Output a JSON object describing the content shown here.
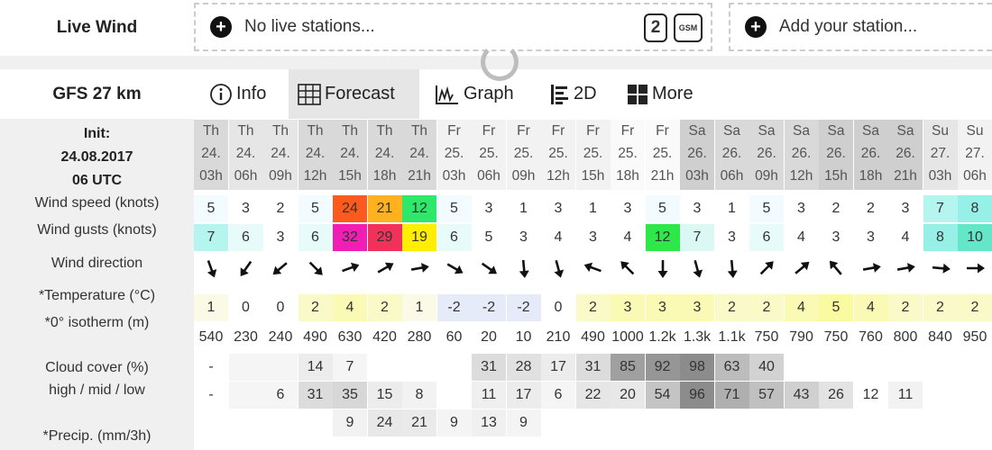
{
  "live": {
    "label": "Live Wind",
    "no_stations": "No live stations...",
    "add_station": "Add your station...",
    "badge_2": "2",
    "badge_gsm": "GSM"
  },
  "model": "GFS 27 km",
  "tabs": [
    {
      "label": "Info",
      "icon": "info-icon",
      "active": false
    },
    {
      "label": "Forecast",
      "icon": "grid-icon",
      "active": true
    },
    {
      "label": "Graph",
      "icon": "graph-icon",
      "active": false
    },
    {
      "label": "2D",
      "icon": "bars-icon",
      "active": false
    },
    {
      "label": "More",
      "icon": "squares-icon",
      "active": false
    }
  ],
  "init": {
    "title": "Init:",
    "date": "24.08.2017",
    "time": "06 UTC"
  },
  "labels": {
    "wind_speed": "Wind speed (knots)",
    "wind_gusts": "Wind gusts (knots)",
    "wind_direction": "Wind direction",
    "temperature": "*Temperature (°C)",
    "isotherm": "*0° isotherm (m)",
    "cloud_cover": "Cloud cover (%)",
    "cloud_layers": "high / mid / low",
    "precip": "*Precip. (mm/3h)"
  },
  "columns": [
    {
      "day": "Th",
      "date": "24.",
      "hour": "03h"
    },
    {
      "day": "Th",
      "date": "24.",
      "hour": "06h"
    },
    {
      "day": "Th",
      "date": "24.",
      "hour": "09h"
    },
    {
      "day": "Th",
      "date": "24.",
      "hour": "12h"
    },
    {
      "day": "Th",
      "date": "24.",
      "hour": "15h"
    },
    {
      "day": "Th",
      "date": "24.",
      "hour": "18h"
    },
    {
      "day": "Th",
      "date": "24.",
      "hour": "21h"
    },
    {
      "day": "Fr",
      "date": "25.",
      "hour": "03h"
    },
    {
      "day": "Fr",
      "date": "25.",
      "hour": "06h"
    },
    {
      "day": "Fr",
      "date": "25.",
      "hour": "09h"
    },
    {
      "day": "Fr",
      "date": "25.",
      "hour": "12h"
    },
    {
      "day": "Fr",
      "date": "25.",
      "hour": "15h"
    },
    {
      "day": "Fr",
      "date": "25.",
      "hour": "18h"
    },
    {
      "day": "Fr",
      "date": "25.",
      "hour": "21h"
    },
    {
      "day": "Sa",
      "date": "26.",
      "hour": "03h"
    },
    {
      "day": "Sa",
      "date": "26.",
      "hour": "06h"
    },
    {
      "day": "Sa",
      "date": "26.",
      "hour": "09h"
    },
    {
      "day": "Sa",
      "date": "26.",
      "hour": "12h"
    },
    {
      "day": "Sa",
      "date": "26.",
      "hour": "15h"
    },
    {
      "day": "Sa",
      "date": "26.",
      "hour": "18h"
    },
    {
      "day": "Sa",
      "date": "26.",
      "hour": "21h"
    },
    {
      "day": "Su",
      "date": "27.",
      "hour": "03h"
    },
    {
      "day": "Su",
      "date": "27.",
      "hour": "06h"
    }
  ],
  "header_shades": [
    "#d9d9d9",
    "#e6e6e6",
    "#e6e6e6",
    "#d9d9d9",
    "#d9d9d9",
    "#d9d9d9",
    "#d9d9d9",
    "#f2f2f2",
    "#f2f2f2",
    "#f2f2f2",
    "#f2f2f2",
    "#f2f2f2",
    "#fafafa",
    "#fafafa",
    "#cfcfcf",
    "#d9d9d9",
    "#d9d9d9",
    "#d9d9d9",
    "#cfcfcf",
    "#cfcfcf",
    "#cfcfcf",
    "#e6e6e6",
    "#f2f2f2"
  ],
  "wind_speed": [
    {
      "v": "5",
      "bg": "#f2fbff"
    },
    {
      "v": "3",
      "bg": ""
    },
    {
      "v": "2",
      "bg": ""
    },
    {
      "v": "5",
      "bg": "#f2fbff"
    },
    {
      "v": "24",
      "bg": "#ff5a1e"
    },
    {
      "v": "21",
      "bg": "#ffb21e"
    },
    {
      "v": "12",
      "bg": "#2ee86a"
    },
    {
      "v": "5",
      "bg": "#f2fbff"
    },
    {
      "v": "3",
      "bg": ""
    },
    {
      "v": "1",
      "bg": ""
    },
    {
      "v": "3",
      "bg": ""
    },
    {
      "v": "1",
      "bg": ""
    },
    {
      "v": "3",
      "bg": ""
    },
    {
      "v": "5",
      "bg": "#f2fbff"
    },
    {
      "v": "3",
      "bg": ""
    },
    {
      "v": "1",
      "bg": ""
    },
    {
      "v": "5",
      "bg": "#f2fbff"
    },
    {
      "v": "3",
      "bg": ""
    },
    {
      "v": "2",
      "bg": ""
    },
    {
      "v": "2",
      "bg": ""
    },
    {
      "v": "3",
      "bg": ""
    },
    {
      "v": "7",
      "bg": "#b4f5f0"
    },
    {
      "v": "8",
      "bg": "#96f0e8"
    }
  ],
  "wind_gusts": [
    {
      "v": "7",
      "bg": "#b4f5f0"
    },
    {
      "v": "6",
      "bg": "#e6fbfa"
    },
    {
      "v": "3",
      "bg": ""
    },
    {
      "v": "6",
      "bg": "#e6fbfa"
    },
    {
      "v": "32",
      "bg": "#f01eb4"
    },
    {
      "v": "29",
      "bg": "#f0325a"
    },
    {
      "v": "19",
      "bg": "#ffee00"
    },
    {
      "v": "6",
      "bg": "#e6fbfa"
    },
    {
      "v": "5",
      "bg": ""
    },
    {
      "v": "3",
      "bg": ""
    },
    {
      "v": "4",
      "bg": ""
    },
    {
      "v": "3",
      "bg": ""
    },
    {
      "v": "4",
      "bg": ""
    },
    {
      "v": "12",
      "bg": "#2ee84a"
    },
    {
      "v": "7",
      "bg": "#dcf8f5"
    },
    {
      "v": "3",
      "bg": ""
    },
    {
      "v": "6",
      "bg": "#e6fbfa"
    },
    {
      "v": "4",
      "bg": ""
    },
    {
      "v": "3",
      "bg": ""
    },
    {
      "v": "3",
      "bg": ""
    },
    {
      "v": "4",
      "bg": ""
    },
    {
      "v": "8",
      "bg": "#96f0e8"
    },
    {
      "v": "10",
      "bg": "#64e6c8"
    }
  ],
  "wind_direction_deg": [
    160,
    215,
    230,
    135,
    70,
    60,
    80,
    120,
    125,
    175,
    165,
    290,
    315,
    180,
    165,
    175,
    45,
    50,
    320,
    80,
    80,
    95,
    90
  ],
  "temperature": [
    {
      "v": "1",
      "bg": "#fafae6"
    },
    {
      "v": "0",
      "bg": ""
    },
    {
      "v": "0",
      "bg": ""
    },
    {
      "v": "2",
      "bg": "#fafac8"
    },
    {
      "v": "4",
      "bg": "#fafab4"
    },
    {
      "v": "2",
      "bg": "#fafac8"
    },
    {
      "v": "1",
      "bg": "#fafae6"
    },
    {
      "v": "-2",
      "bg": "#e6ebfa"
    },
    {
      "v": "-2",
      "bg": "#e6ebfa"
    },
    {
      "v": "-2",
      "bg": "#e6ebfa"
    },
    {
      "v": "0",
      "bg": ""
    },
    {
      "v": "2",
      "bg": "#fafac8"
    },
    {
      "v": "3",
      "bg": "#fafab4"
    },
    {
      "v": "3",
      "bg": "#fafab4"
    },
    {
      "v": "3",
      "bg": "#fafab4"
    },
    {
      "v": "2",
      "bg": "#fafac8"
    },
    {
      "v": "2",
      "bg": "#fafac8"
    },
    {
      "v": "4",
      "bg": "#fafab4"
    },
    {
      "v": "5",
      "bg": "#fafaa0"
    },
    {
      "v": "4",
      "bg": "#fafab4"
    },
    {
      "v": "2",
      "bg": "#fafac8"
    },
    {
      "v": "2",
      "bg": "#fafac8"
    },
    {
      "v": "2",
      "bg": "#fafac8"
    }
  ],
  "isotherm": [
    "540",
    "230",
    "240",
    "490",
    "630",
    "420",
    "280",
    "60",
    "20",
    "10",
    "210",
    "490",
    "1000",
    "1.2k",
    "1.3k",
    "1.1k",
    "750",
    "790",
    "750",
    "760",
    "800",
    "840",
    "950"
  ],
  "cloud_high": [
    {
      "v": "-",
      "bg": ""
    },
    {
      "v": "",
      "bg": "#f5f5f5"
    },
    {
      "v": "",
      "bg": "#f5f5f5"
    },
    {
      "v": "14",
      "bg": "#ececec"
    },
    {
      "v": "7",
      "bg": "#f5f5f5"
    },
    {
      "v": "",
      "bg": ""
    },
    {
      "v": "",
      "bg": ""
    },
    {
      "v": "",
      "bg": ""
    },
    {
      "v": "31",
      "bg": "#dcdcdc"
    },
    {
      "v": "28",
      "bg": "#e1e1e1"
    },
    {
      "v": "17",
      "bg": "#ececec"
    },
    {
      "v": "31",
      "bg": "#dcdcdc"
    },
    {
      "v": "85",
      "bg": "#a0a0a0"
    },
    {
      "v": "92",
      "bg": "#969696"
    },
    {
      "v": "98",
      "bg": "#8c8c8c"
    },
    {
      "v": "63",
      "bg": "#bcbcbc"
    },
    {
      "v": "40",
      "bg": "#d2d2d2"
    },
    {
      "v": "",
      "bg": ""
    },
    {
      "v": "",
      "bg": ""
    },
    {
      "v": "",
      "bg": ""
    },
    {
      "v": "",
      "bg": ""
    },
    {
      "v": "",
      "bg": ""
    },
    {
      "v": "",
      "bg": ""
    }
  ],
  "cloud_mid": [
    {
      "v": "-",
      "bg": ""
    },
    {
      "v": "",
      "bg": "#f5f5f5"
    },
    {
      "v": "6",
      "bg": "#f5f5f5"
    },
    {
      "v": "31",
      "bg": "#dcdcdc"
    },
    {
      "v": "35",
      "bg": "#d7d7d7"
    },
    {
      "v": "15",
      "bg": "#ececec"
    },
    {
      "v": "8",
      "bg": "#f2f2f2"
    },
    {
      "v": "",
      "bg": ""
    },
    {
      "v": "11",
      "bg": "#efefef"
    },
    {
      "v": "17",
      "bg": "#ececec"
    },
    {
      "v": "6",
      "bg": "#f5f5f5"
    },
    {
      "v": "22",
      "bg": "#e6e6e6"
    },
    {
      "v": "20",
      "bg": "#e8e8e8"
    },
    {
      "v": "54",
      "bg": "#c4c4c4"
    },
    {
      "v": "96",
      "bg": "#8c8c8c"
    },
    {
      "v": "71",
      "bg": "#afafaf"
    },
    {
      "v": "57",
      "bg": "#c0c0c0"
    },
    {
      "v": "43",
      "bg": "#d0d0d0"
    },
    {
      "v": "26",
      "bg": "#e3e3e3"
    },
    {
      "v": "12",
      "bg": ""
    },
    {
      "v": "11",
      "bg": "#f2f2f2"
    },
    {
      "v": "",
      "bg": ""
    },
    {
      "v": "",
      "bg": ""
    }
  ],
  "precip": [
    {
      "v": "",
      "bg": ""
    },
    {
      "v": "",
      "bg": ""
    },
    {
      "v": "",
      "bg": ""
    },
    {
      "v": "",
      "bg": ""
    },
    {
      "v": "9",
      "bg": "#f2f2f2"
    },
    {
      "v": "24",
      "bg": "#e8e8e8"
    },
    {
      "v": "21",
      "bg": "#eaeaea"
    },
    {
      "v": "9",
      "bg": "#f4f4f4"
    },
    {
      "v": "13",
      "bg": "#f0f0f0"
    },
    {
      "v": "9",
      "bg": "#f4f4f4"
    },
    {
      "v": "",
      "bg": ""
    },
    {
      "v": "",
      "bg": ""
    },
    {
      "v": "",
      "bg": ""
    },
    {
      "v": "",
      "bg": ""
    },
    {
      "v": "",
      "bg": ""
    },
    {
      "v": "",
      "bg": ""
    },
    {
      "v": "",
      "bg": ""
    },
    {
      "v": "",
      "bg": ""
    },
    {
      "v": "",
      "bg": ""
    },
    {
      "v": "",
      "bg": ""
    },
    {
      "v": "",
      "bg": ""
    },
    {
      "v": "",
      "bg": ""
    },
    {
      "v": "",
      "bg": ""
    }
  ]
}
